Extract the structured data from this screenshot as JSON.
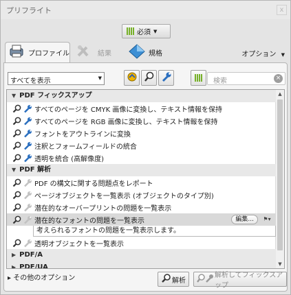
{
  "window": {
    "title": "プリフライト",
    "close": "x"
  },
  "profile_selector": {
    "label": "必須"
  },
  "tabs": [
    {
      "label": "プロファイル",
      "active": true
    },
    {
      "label": "結果",
      "active": false
    },
    {
      "label": "規格",
      "active": false
    }
  ],
  "options_menu": {
    "label": "オプション"
  },
  "toolbar": {
    "filter_value": "すべてを表示",
    "search_placeholder": "検索"
  },
  "list": {
    "rows": [
      {
        "type": "group",
        "label": "PDF フィックスアップ"
      },
      {
        "type": "item",
        "label": "すべてのページを CMYK 画像に変換し、テキスト情報を保持"
      },
      {
        "type": "item",
        "label": "すべてのページを RGB 画像に変換し、テキスト情報を保持"
      },
      {
        "type": "item",
        "label": "フォントをアウトラインに変換"
      },
      {
        "type": "item",
        "label": "注釈とフォームフィールドの統合"
      },
      {
        "type": "item",
        "label": "透明を統合 (高解像度)"
      },
      {
        "type": "group",
        "label": "PDF 解析"
      },
      {
        "type": "item",
        "label": "PDF の構文に関する問題点をレポート"
      },
      {
        "type": "item",
        "label": "ページオブジェクトを一覧表示 (オブジェクトのタイプ別)"
      },
      {
        "type": "item",
        "label": "潜在的なオーバープリントの問題を一覧表示"
      },
      {
        "type": "item",
        "label": "潜在的なフォントの問題を一覧表示",
        "selected": true
      },
      {
        "type": "desc",
        "label": "考えられるフォントの問題を一覧表示します。"
      },
      {
        "type": "item",
        "label": "透明オブジェクトを一覧表示"
      },
      {
        "type": "group",
        "label": "PDF/A",
        "collapsed": true
      },
      {
        "type": "group",
        "label": "PDF/UA",
        "collapsed": true
      }
    ],
    "edit_button": "編集..."
  },
  "footer": {
    "more_options": "その他のオプション",
    "analyze_button": "解析",
    "analyze_fix_button": "解析してフィックスアップ"
  },
  "colors": {
    "accent_green": "#76b028",
    "wrench_blue": "#2b6fbf",
    "selected_row": "#d9d9d9"
  }
}
